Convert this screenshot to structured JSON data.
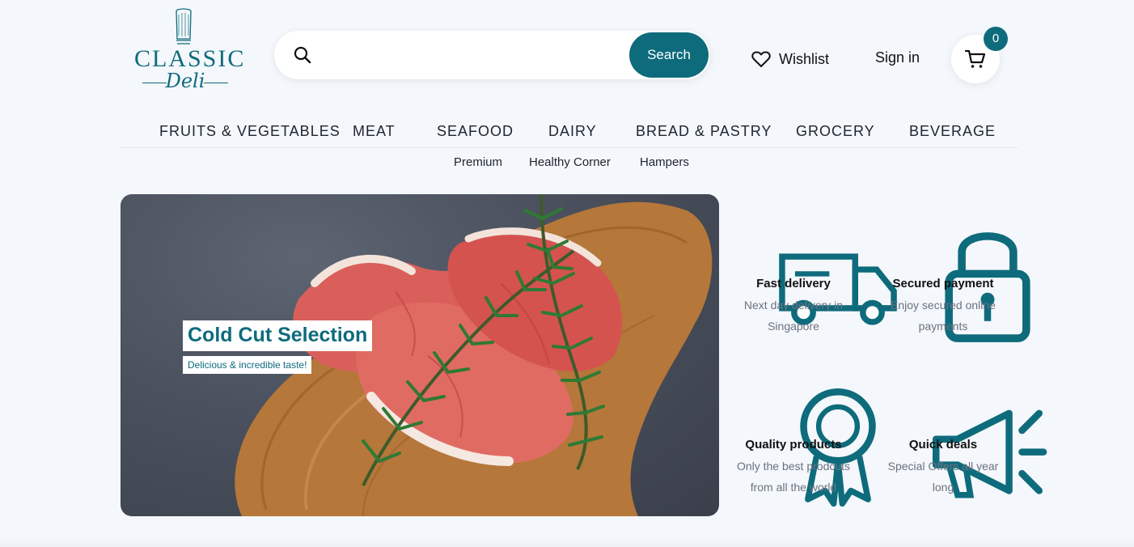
{
  "brand": {
    "word": "CLASSIC",
    "script": "Deli"
  },
  "search": {
    "placeholder": "",
    "button_label": "Search"
  },
  "header": {
    "wishlist_label": "Wishlist",
    "signin_label": "Sign in",
    "cart_count": "0"
  },
  "nav": {
    "main": [
      "FRUITS & VEGETABLES",
      "MEAT",
      "SEAFOOD",
      "DAIRY",
      "BREAD & PASTRY",
      "GROCERY",
      "BEVERAGE"
    ],
    "sub": [
      "Premium",
      "Healthy Corner",
      "Hampers"
    ]
  },
  "hero": {
    "title": "Cold Cut Selection",
    "subtitle": "Delicious & incredible taste!"
  },
  "features": [
    {
      "icon": "truck-icon",
      "title": "Fast delivery",
      "desc_line1": "Next day delivery in",
      "desc_line2": "Singapore"
    },
    {
      "icon": "lock-icon",
      "title": "Secured payment",
      "desc_line1": "Enjoy secured online",
      "desc_line2": "payments"
    },
    {
      "icon": "award-icon",
      "title": "Quality products",
      "desc_line1": "Only the best prodcuts",
      "desc_line2": "from all the world"
    },
    {
      "icon": "megaphone-icon",
      "title": "Quick deals",
      "desc_line1": "Special Offers all year",
      "desc_line2": "long"
    }
  ],
  "colors": {
    "accent": "#0e6b7c",
    "background": "#f4f7fb"
  }
}
